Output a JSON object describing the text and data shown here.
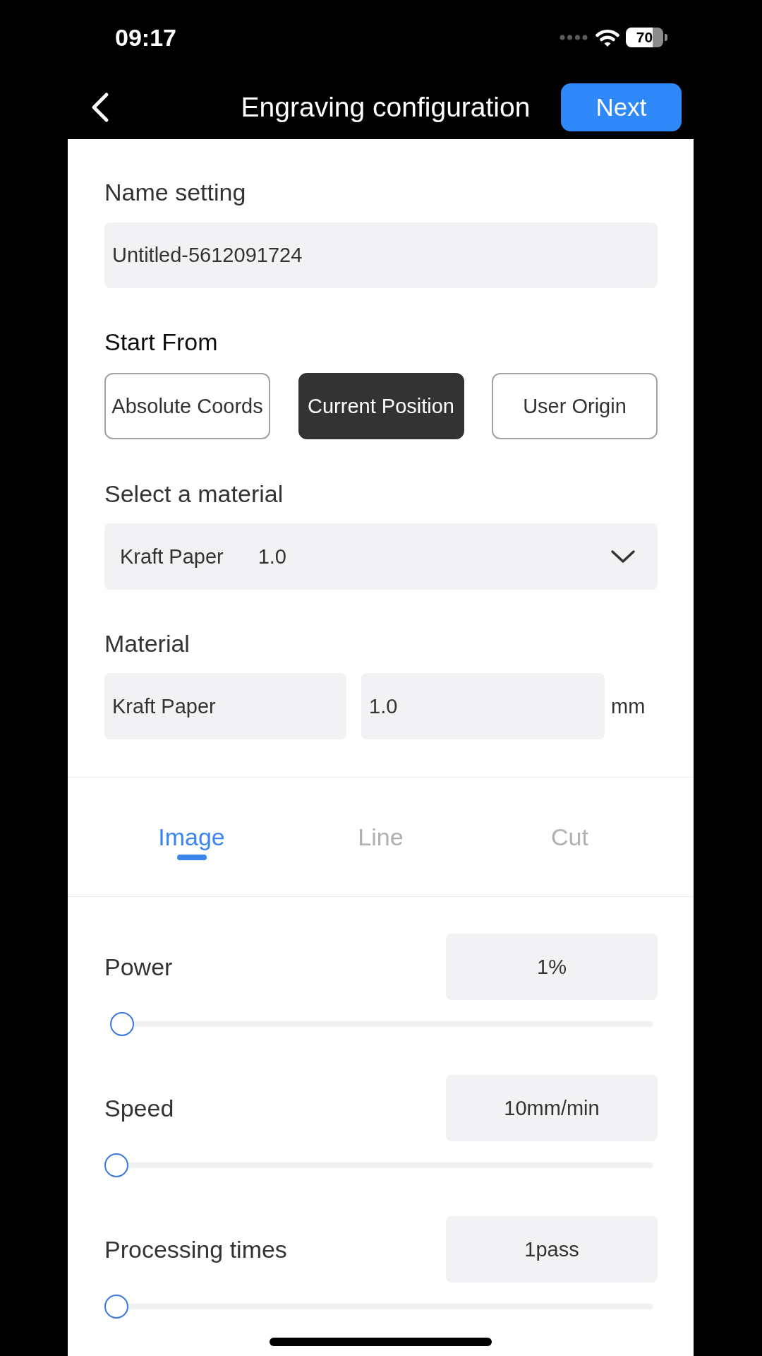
{
  "status_bar": {
    "time": "09:17",
    "battery": "70"
  },
  "header": {
    "title": "Engraving configuration",
    "next_button": "Next"
  },
  "name_setting": {
    "label": "Name setting",
    "value": "Untitled-5612091724"
  },
  "start_from": {
    "label": "Start From",
    "options": [
      {
        "label": "Absolute Coords",
        "selected": false
      },
      {
        "label": "Current Position",
        "selected": true
      },
      {
        "label": "User Origin",
        "selected": false
      }
    ]
  },
  "material_select": {
    "label": "Select a material",
    "material": "Kraft Paper",
    "thickness": "1.0"
  },
  "material": {
    "label": "Material",
    "name": "Kraft Paper",
    "thickness": "1.0",
    "unit": "mm"
  },
  "tabs": [
    {
      "label": "Image",
      "selected": true
    },
    {
      "label": "Line",
      "selected": false
    },
    {
      "label": "Cut",
      "selected": false
    }
  ],
  "parameters": [
    {
      "label": "Power",
      "value": "1%",
      "level": 0.01
    },
    {
      "label": "Speed",
      "value": "10mm/min",
      "level": 0
    },
    {
      "label": "Processing times",
      "value": "1pass",
      "level": 0
    }
  ]
}
